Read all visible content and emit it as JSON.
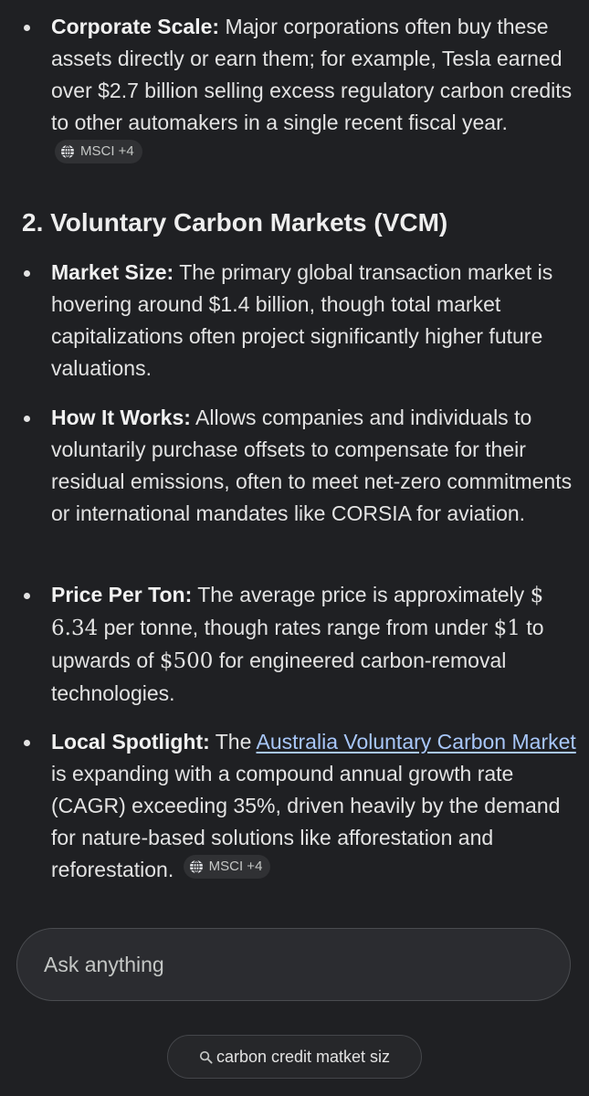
{
  "items_top": {
    "corporate_scale": {
      "label": "Corporate Scale:",
      "text": " Major corporations often buy these assets directly or earn them; for example, Tesla earned over $2.7 billion selling excess regulatory carbon credits to other automakers in a single recent fiscal year.",
      "chip": "MSCI +4"
    }
  },
  "section": {
    "heading": "2. Voluntary Carbon Markets (VCM)",
    "market_size": {
      "label": "Market Size:",
      "text": " The primary global transaction market is hovering around $1.4 billion, though total market capitalizations often project significantly higher future valuations."
    },
    "how_it_works": {
      "label": "How It Works:",
      "text": " Allows companies and individuals to voluntarily purchase offsets to compensate for their residual emissions, often to meet net-zero commitments or international mandates like CORSIA for aviation."
    },
    "price_per_ton": {
      "label": "Price Per Ton:",
      "text_1": " The average price is approximately ",
      "math_1": "$ 6.34",
      "text_2": " per tonne, though rates range from under ",
      "math_2": "$1",
      "text_3": " to upwards of ",
      "math_3": "$500",
      "text_4": " for engineered carbon-removal technologies."
    },
    "local_spotlight": {
      "label": "Local Spotlight:",
      "text_1": " The ",
      "link": "Australia Voluntary Carbon Market",
      "text_2": " is expanding with a compound annual growth rate (CAGR) exceeding 35%, driven heavily by the demand for nature-based solutions like afforestation and reforestation.",
      "chip": "MSCI +4"
    }
  },
  "composer": {
    "placeholder": "Ask anything"
  },
  "suggestion": {
    "label": "carbon credit matket siz",
    "icon": "search-icon"
  },
  "colors": {
    "background": "#1f2023",
    "text": "#e3e3e3",
    "link": "#a8c7fa",
    "chip_bg": "#303134"
  }
}
